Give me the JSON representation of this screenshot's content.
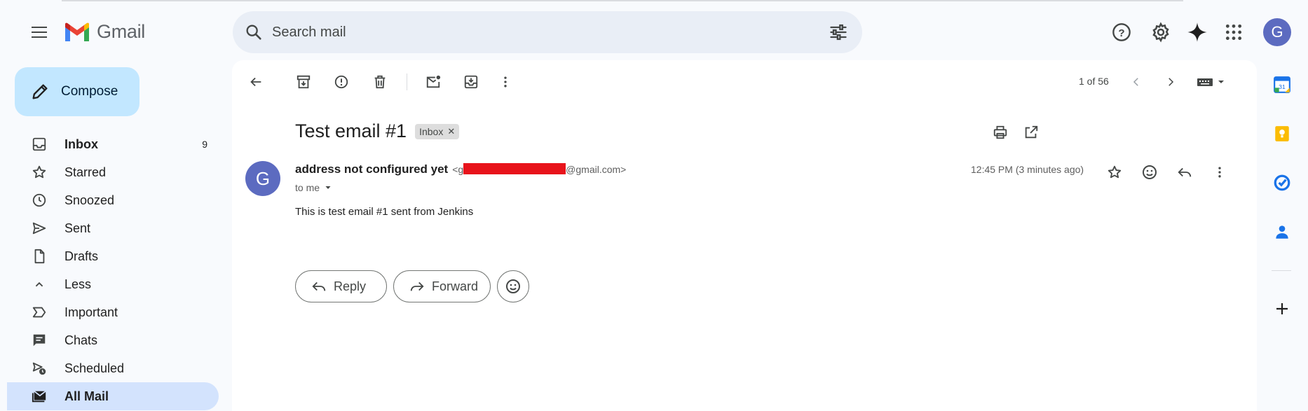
{
  "app": {
    "name": "Gmail"
  },
  "search": {
    "placeholder": "Search mail"
  },
  "compose": {
    "label": "Compose"
  },
  "sidebar": {
    "items": [
      {
        "label": "Inbox",
        "count": "9",
        "icon": "inbox-icon",
        "bold": true
      },
      {
        "label": "Starred",
        "count": "",
        "icon": "star-icon"
      },
      {
        "label": "Snoozed",
        "count": "",
        "icon": "clock-icon"
      },
      {
        "label": "Sent",
        "count": "",
        "icon": "send-icon"
      },
      {
        "label": "Drafts",
        "count": "",
        "icon": "draft-icon"
      },
      {
        "label": "Less",
        "count": "",
        "icon": "chevron-up-icon"
      },
      {
        "label": "Important",
        "count": "",
        "icon": "important-icon"
      },
      {
        "label": "Chats",
        "count": "",
        "icon": "chat-icon"
      },
      {
        "label": "Scheduled",
        "count": "",
        "icon": "scheduled-icon"
      },
      {
        "label": "All Mail",
        "count": "",
        "icon": "all-mail-icon",
        "active": true,
        "bold": true
      }
    ]
  },
  "pager": {
    "text": "1 of 56"
  },
  "message": {
    "subject": "Test email #1",
    "label": "Inbox",
    "sender_initial": "G",
    "sender_name": "address not configured yet",
    "sender_email_prefix": "<g",
    "sender_email_suffix": "@gmail.com>",
    "to": "to me",
    "time": "12:45 PM (3 minutes ago)",
    "body": "This is test email #1 sent from Jenkins"
  },
  "actions": {
    "reply": "Reply",
    "forward": "Forward"
  },
  "account": {
    "initial": "G"
  },
  "colors": {
    "accent": "#0b57d0",
    "compose_bg": "#c2e7ff",
    "active_nav": "#d3e3fd",
    "avatar": "#5c6bc0",
    "redaction": "#e8131b"
  }
}
